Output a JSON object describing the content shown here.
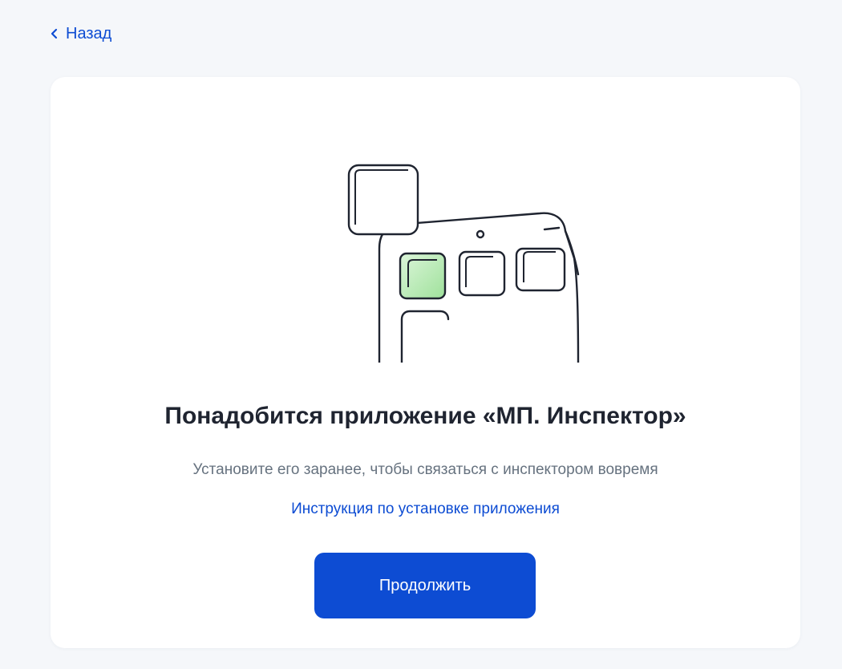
{
  "nav": {
    "back_label": "Назад"
  },
  "card": {
    "title": "Понадобится приложение «МП. Инспектор»",
    "subtitle": "Установите его заранее, чтобы связаться с инспектором вовремя",
    "instruction_link": "Инструкция по установке приложения",
    "continue_label": "Продолжить"
  },
  "colors": {
    "background": "#f5f7fa",
    "accent": "#0d4cd3",
    "title": "#1f2430",
    "muted_text": "#66727f",
    "app_icon_fill": "#b9ebb5"
  },
  "icons": {
    "back": "chevron-left-icon",
    "illustration": "phone-app-illustration"
  }
}
